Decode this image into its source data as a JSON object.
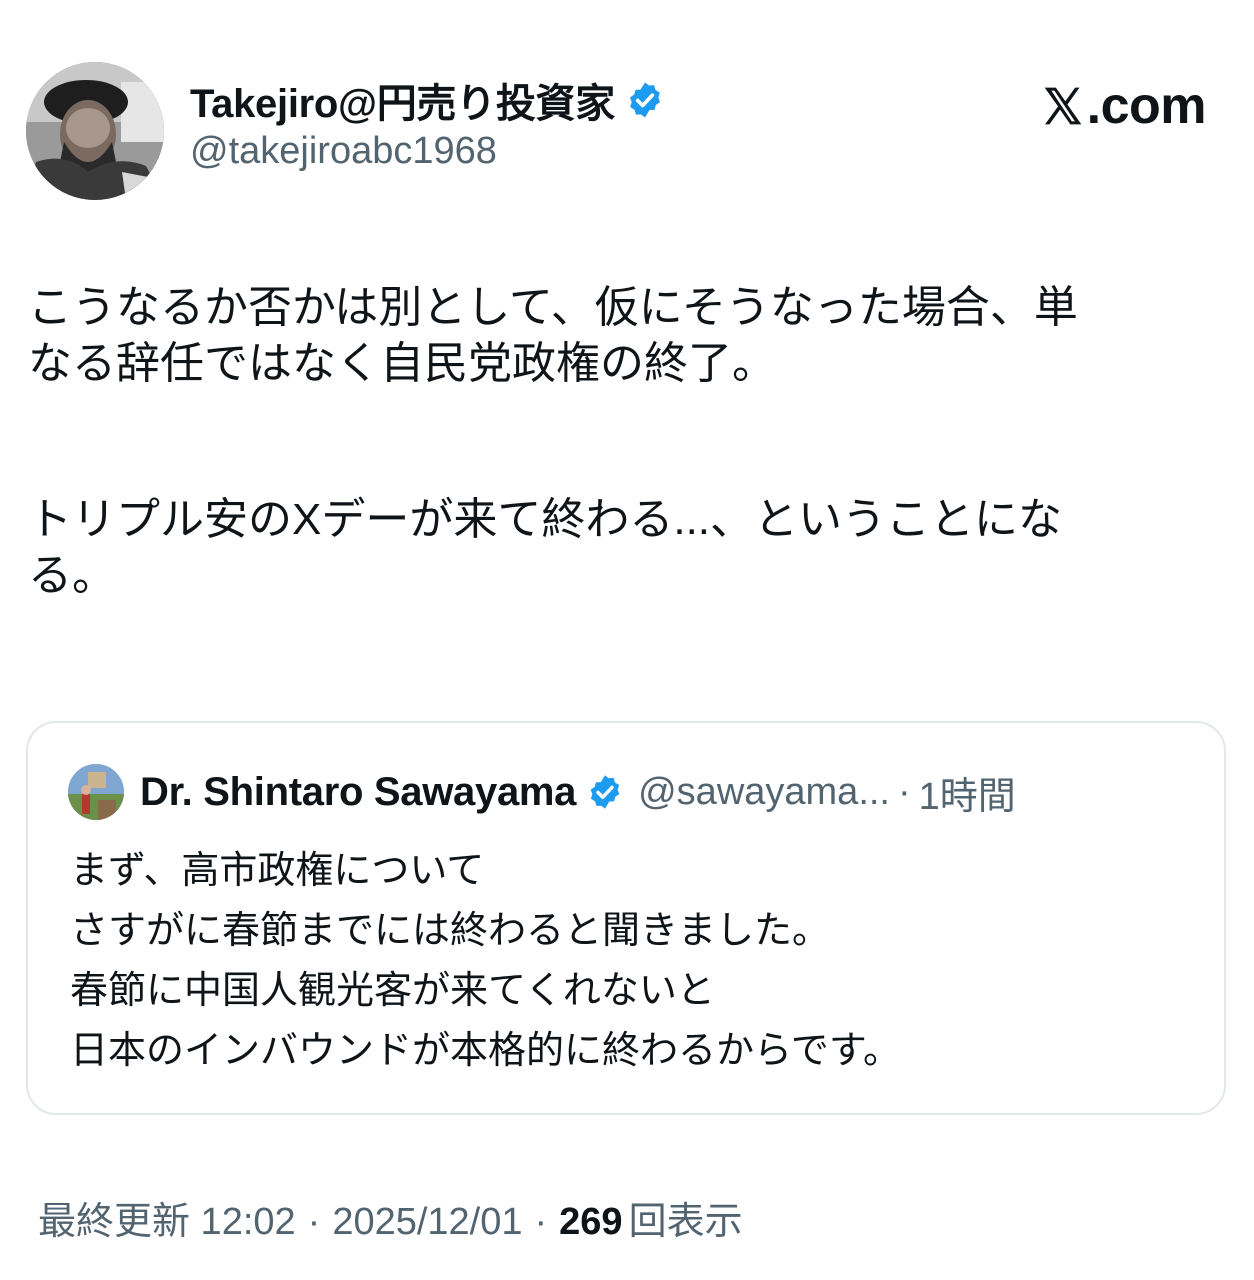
{
  "author": {
    "display_name": "Takejiro@円売り投資家",
    "handle": "@takejiroabc1968",
    "verified": true
  },
  "brand": {
    "label": ".com"
  },
  "tweet": {
    "paragraph_1": "こうなるか否かは別として、仮にそうなった場合、単\nなる辞任ではなく自民党政権の終了。",
    "paragraph_2": "トリプル安のXデーが来て終わる...、ということにな\nる。"
  },
  "quote": {
    "display_name": "Dr. Shintaro Sawayama",
    "handle": "@sawayama...",
    "separator": "·",
    "time": "1時間",
    "lines": [
      "まず、高市政権について",
      "さすがに春節までには終わると聞きました。",
      "春節に中国人観光客が来てくれないと",
      "日本のインバウンドが本格的に終わるからです。"
    ]
  },
  "meta": {
    "updated_label": "最終更新 12:02",
    "separator": "·",
    "date": "2025/12/01",
    "views_count": "269",
    "views_label": "回表示"
  },
  "colors": {
    "verified_blue": "#1d9bf0",
    "secondary_text": "#536471",
    "primary_text": "#0f1419",
    "card_border": "#e1e8ed"
  }
}
